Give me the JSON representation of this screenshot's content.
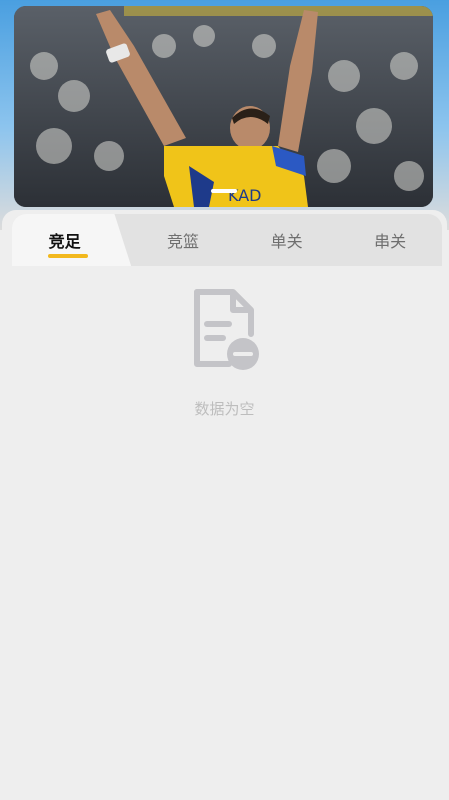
{
  "banner": {
    "image_icon": "soccer-player-celebrating-photo",
    "indicator_count": 1
  },
  "tabs": [
    {
      "label": "竞足",
      "active": true
    },
    {
      "label": "竞篮",
      "active": false
    },
    {
      "label": "单关",
      "active": false
    },
    {
      "label": "串关",
      "active": false
    }
  ],
  "empty_state": {
    "icon": "document-remove-icon",
    "message": "数据为空"
  },
  "colors": {
    "accent": "#f2b81d",
    "background": "#eeeeee",
    "muted_text": "#bdbdbd"
  }
}
